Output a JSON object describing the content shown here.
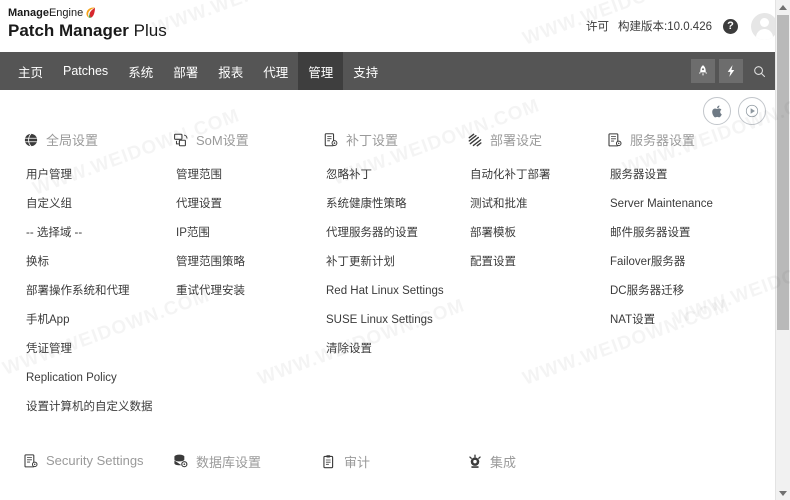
{
  "brand": {
    "line1_bold": "Manage",
    "line1_light": "Engine",
    "line2_bold": "Patch Manager",
    "line2_light": "Plus",
    "swoosh_icon": "manageengine-swoosh-icon"
  },
  "header": {
    "license_label": "许可",
    "build_label": "构建版本:10.0.426",
    "help_icon": "help-question-icon",
    "help_label": "?",
    "avatar_icon": "user-avatar-icon"
  },
  "nav": {
    "items": [
      {
        "label": "主页",
        "active": false
      },
      {
        "label": "Patches",
        "active": false
      },
      {
        "label": "系统",
        "active": false
      },
      {
        "label": "部署",
        "active": false
      },
      {
        "label": "报表",
        "active": false
      },
      {
        "label": "代理",
        "active": false
      },
      {
        "label": "管理",
        "active": true
      },
      {
        "label": "支持",
        "active": false
      }
    ],
    "right_icons": [
      {
        "name": "rocket-icon",
        "boxed": true
      },
      {
        "name": "lightning-bolt-icon",
        "boxed": true
      },
      {
        "name": "search-icon",
        "boxed": false
      }
    ],
    "active_bg": "#3e3e3e",
    "bar_bg": "#555555"
  },
  "float_buttons": [
    {
      "name": "apple-icon"
    },
    {
      "name": "play-video-icon"
    }
  ],
  "columns": [
    {
      "icon": "globe-icon",
      "title": "全局设置",
      "links": [
        "用户管理",
        "自定义组",
        "-- 选择域 --",
        "换标",
        "部署操作系统和代理",
        "手机App",
        "凭证管理",
        "Replication Policy",
        "设置计算机的自定义数据"
      ]
    },
    {
      "icon": "scope-of-management-icon",
      "title": "SoM设置",
      "links": [
        "管理范围",
        "代理设置",
        "IP范围",
        "管理范围策略",
        "重试代理安装"
      ]
    },
    {
      "icon": "patch-settings-icon",
      "title": "补丁设置",
      "links": [
        "忽略补丁",
        "系统健康性策略",
        "代理服务器的设置",
        "补丁更新计划",
        "Red Hat Linux Settings",
        "SUSE Linux Settings",
        "清除设置"
      ]
    },
    {
      "icon": "deployment-icon",
      "title": "部署设定",
      "links": [
        "自动化补丁部署",
        "测试和批准",
        "部署模板",
        "配置设置"
      ]
    },
    {
      "icon": "server-settings-icon",
      "title": "服务器设置",
      "links": [
        "服务器设置",
        "Server Maintenance",
        "邮件服务器设置",
        "Failover服务器",
        "DC服务器迁移",
        "NAT设置"
      ]
    }
  ],
  "bottom_sections": [
    {
      "icon": "security-settings-icon",
      "title": "Security Settings"
    },
    {
      "icon": "database-icon",
      "title": "数据库设置"
    },
    {
      "icon": "clipboard-audit-icon",
      "title": "审计"
    },
    {
      "icon": "integration-icon",
      "title": "集成"
    }
  ],
  "scrollbar": {
    "up_icon": "scroll-up-arrow-icon",
    "down_icon": "scroll-down-arrow-icon"
  },
  "watermarks": [
    "WWW.WEIDOWN.COM",
    "WWW.WEIDOWN.COM",
    "WWW.WEIDOWN.COM",
    "WWW.WEIDOWN.COM",
    "WWW.WEIDOWN.COM",
    "WWW.WEIDOWN.COM",
    "WWW.WEIDOWN.COM",
    "WWW.WEIDOWN.COM",
    "WWW.WEIDOWN.COM"
  ]
}
